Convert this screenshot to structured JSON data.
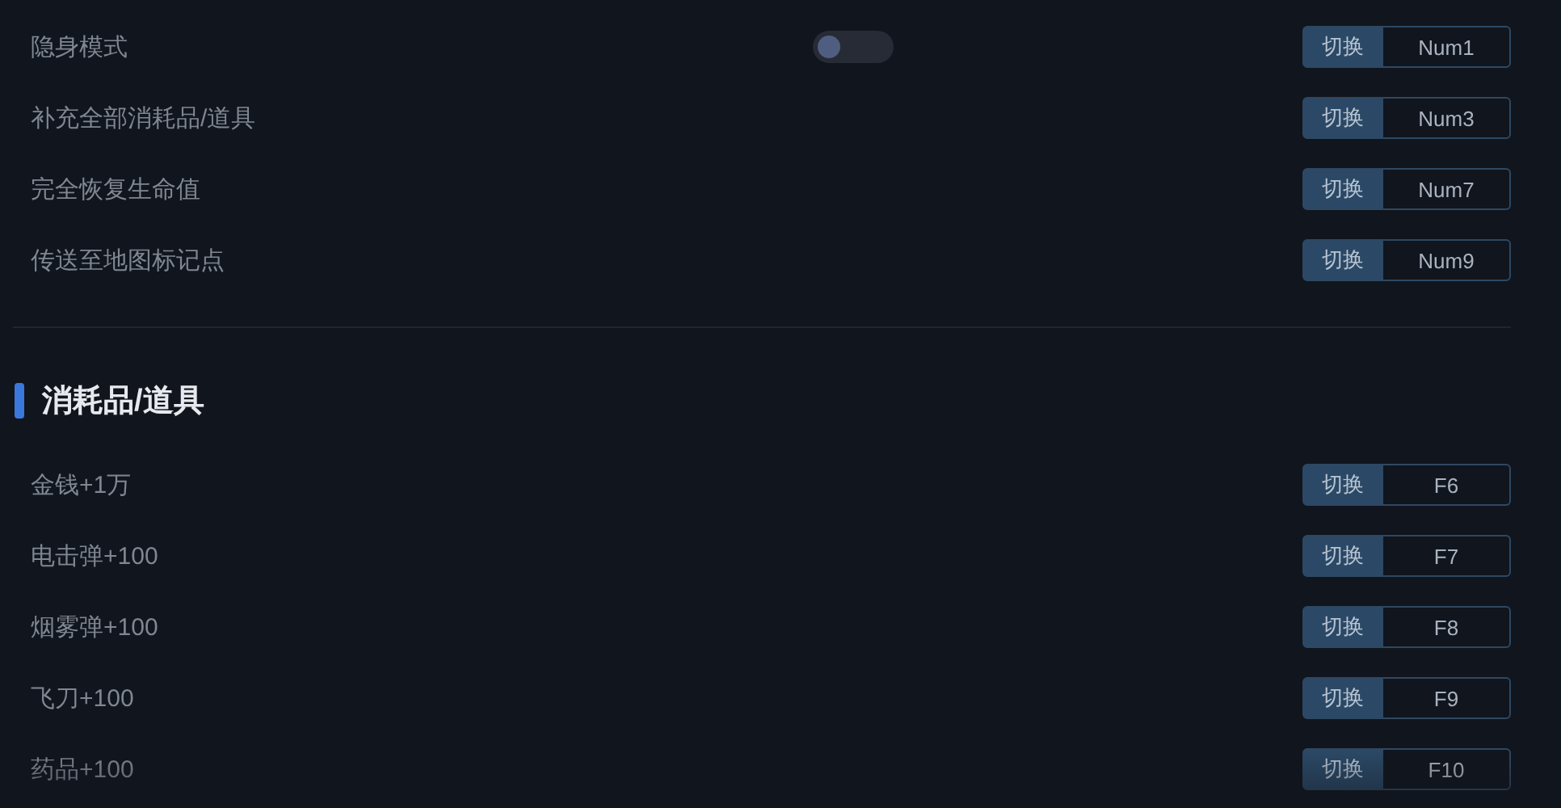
{
  "sections": [
    {
      "items": [
        {
          "label": "隐身模式",
          "kind": "toggle",
          "on": false,
          "action": "切换",
          "key": "Num1"
        },
        {
          "label": "补充全部消耗品/道具",
          "kind": "plain",
          "action": "切换",
          "key": "Num3"
        },
        {
          "label": "完全恢复生命值",
          "kind": "plain",
          "action": "切换",
          "key": "Num7"
        },
        {
          "label": "传送至地图标记点",
          "kind": "plain",
          "action": "切换",
          "key": "Num9"
        }
      ]
    },
    {
      "title": "消耗品/道具",
      "items": [
        {
          "label": "金钱+1万",
          "kind": "plain",
          "action": "切换",
          "key": "F6"
        },
        {
          "label": "电击弹+100",
          "kind": "plain",
          "action": "切换",
          "key": "F7"
        },
        {
          "label": "烟雾弹+100",
          "kind": "plain",
          "action": "切换",
          "key": "F8"
        },
        {
          "label": "飞刀+100",
          "kind": "plain",
          "action": "切换",
          "key": "F9"
        },
        {
          "label": "药品+100",
          "kind": "plain",
          "action": "切换",
          "key": "F10"
        }
      ]
    }
  ]
}
